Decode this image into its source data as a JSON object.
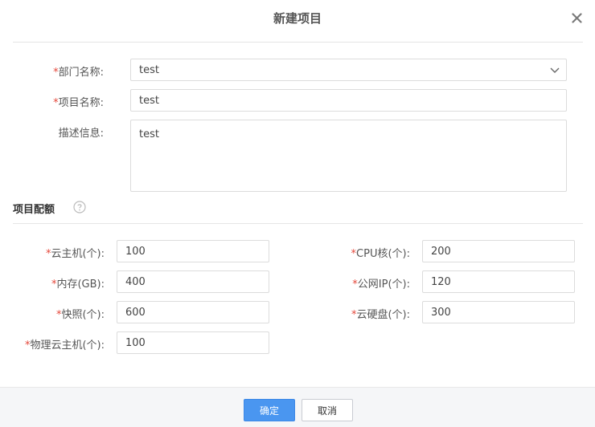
{
  "dialog": {
    "title": "新建项目"
  },
  "form": {
    "department": {
      "required_mark": "*",
      "label": "部门名称:",
      "value": "test"
    },
    "project_name": {
      "required_mark": "*",
      "label": "项目名称:",
      "value": "test"
    },
    "description": {
      "label": "描述信息:",
      "value": "test"
    }
  },
  "quota": {
    "section_title": "项目配额",
    "help_icon": "question-circle-icon",
    "left": [
      {
        "required_mark": "*",
        "label": "云主机(个):",
        "value": "100"
      },
      {
        "required_mark": "*",
        "label": "内存(GB):",
        "value": "400"
      },
      {
        "required_mark": "*",
        "label": "快照(个):",
        "value": "600"
      },
      {
        "required_mark": "*",
        "label": "物理云主机(个):",
        "value": "100"
      }
    ],
    "right": [
      {
        "required_mark": "*",
        "label": "CPU核(个):",
        "value": "200"
      },
      {
        "required_mark": "*",
        "label": "公网IP(个):",
        "value": "120"
      },
      {
        "required_mark": "*",
        "label": "云硬盘(个):",
        "value": "300"
      }
    ]
  },
  "footer": {
    "confirm_label": "确定",
    "cancel_label": "取消"
  },
  "colors": {
    "primary": "#4a96f0",
    "required": "#e5483b"
  }
}
